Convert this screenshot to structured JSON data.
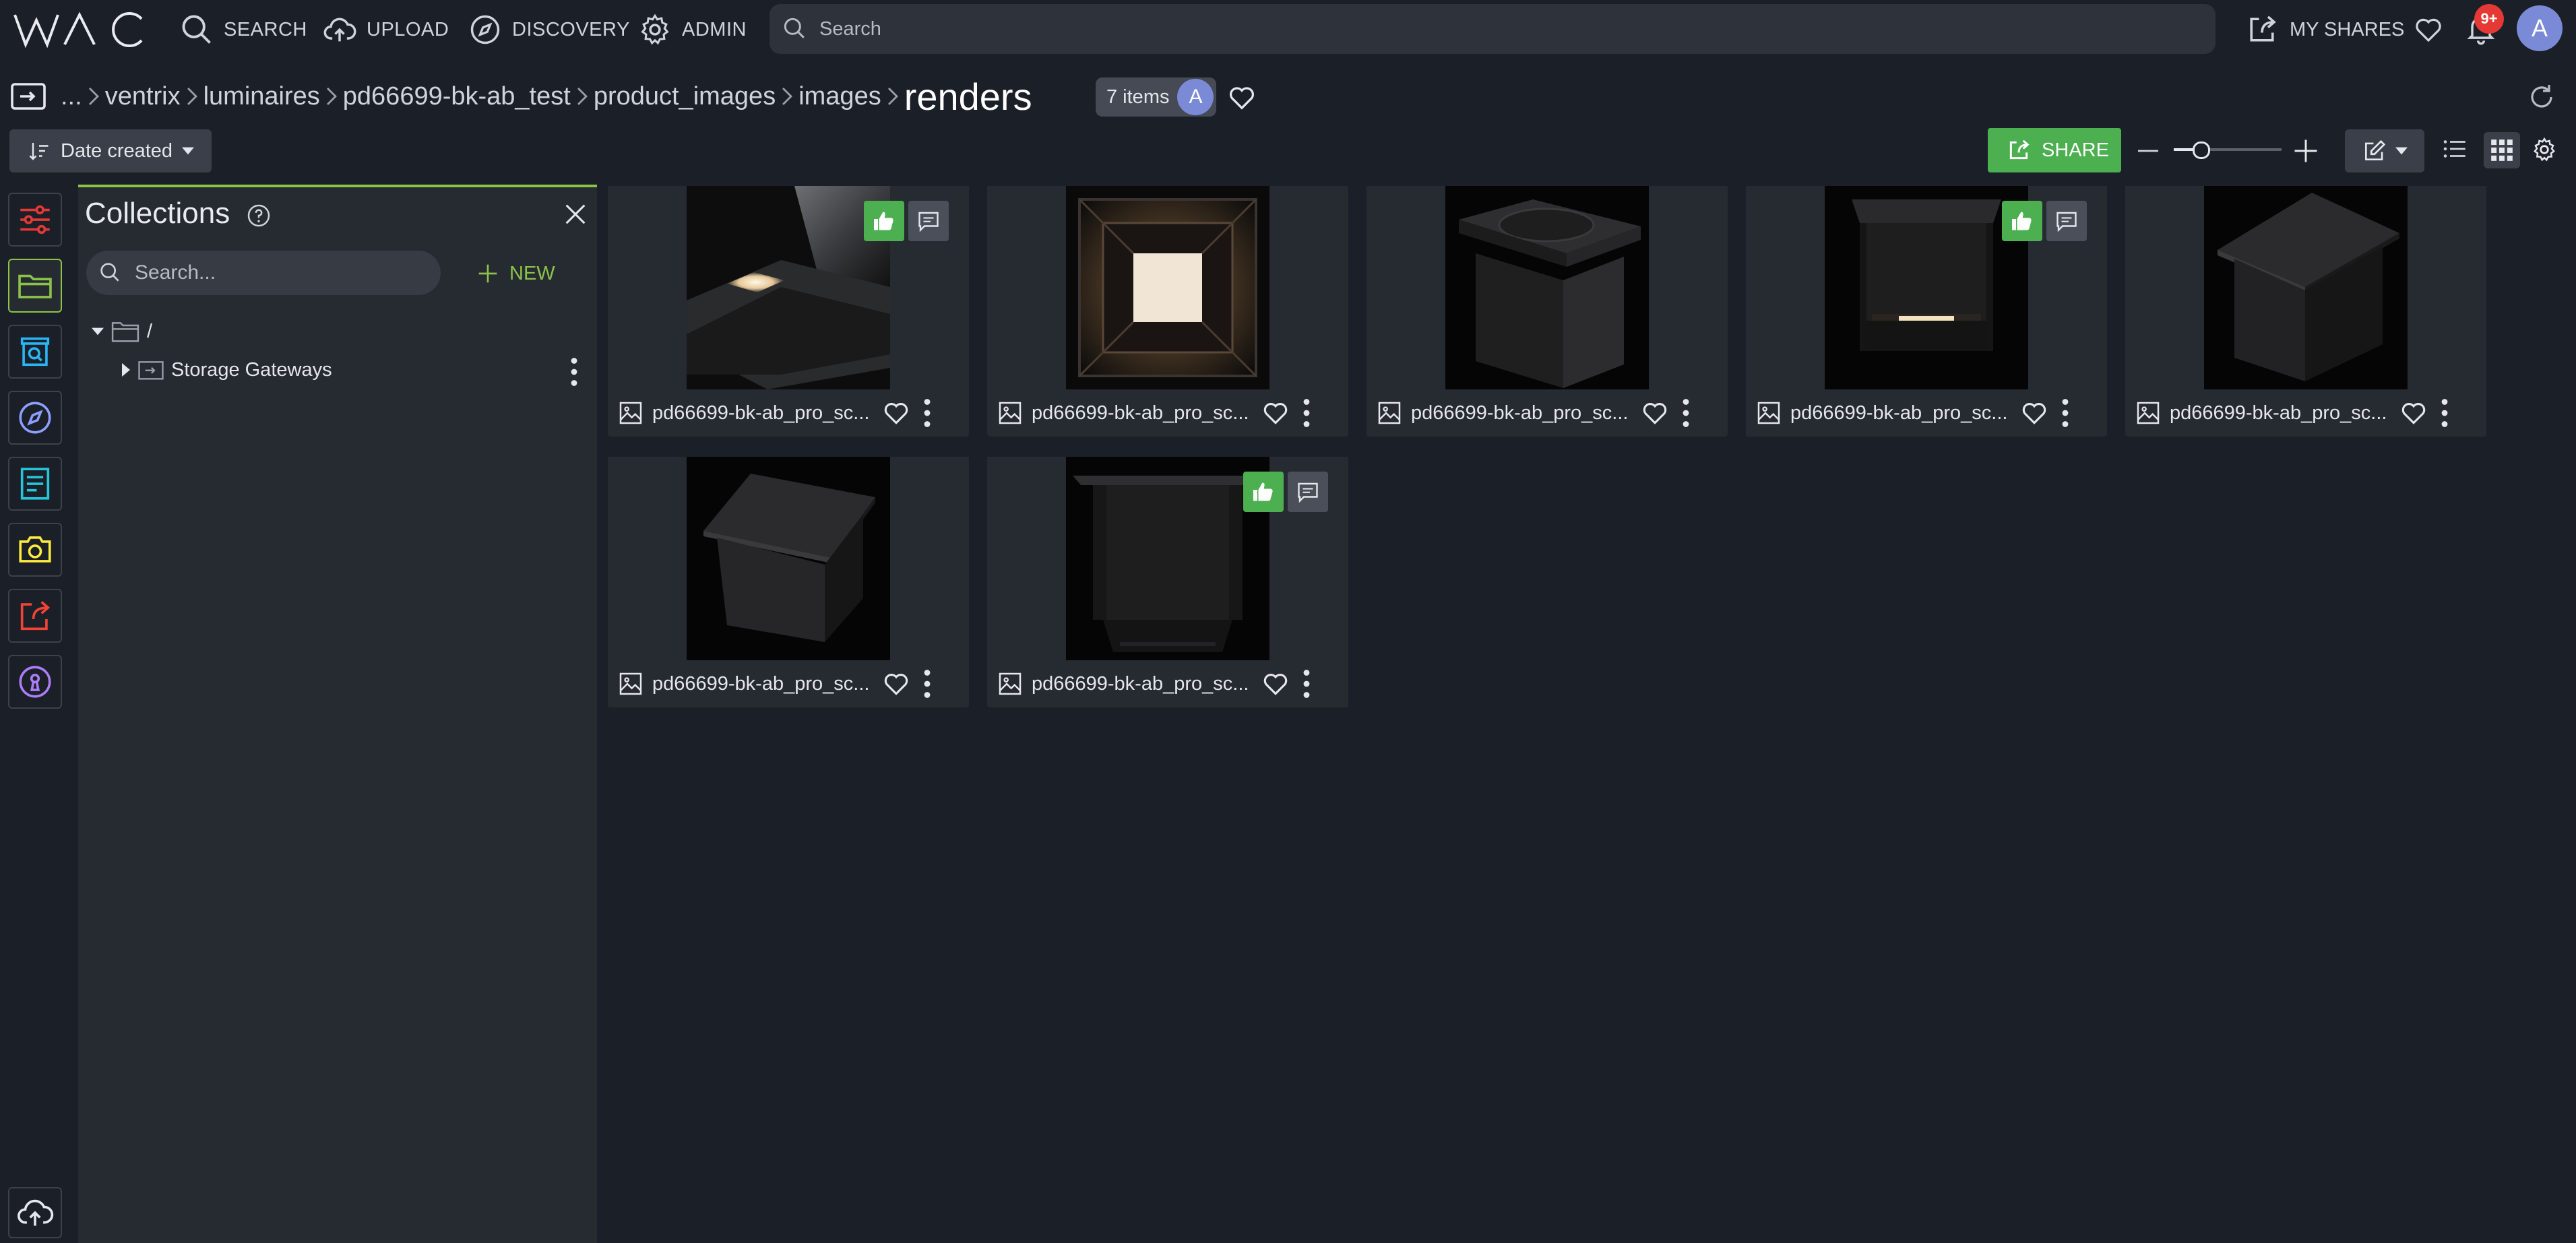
{
  "app": {
    "logo_text": "WAC"
  },
  "nav": {
    "search": "SEARCH",
    "upload": "UPLOAD",
    "discovery": "DISCOVERY",
    "admin": "ADMIN",
    "search_placeholder": "Search",
    "my_shares": "MY SHARES",
    "notifications_badge": "9+",
    "avatar_initial": "A"
  },
  "breadcrumb": {
    "ellipsis": "...",
    "items": [
      "ventrix",
      "luminaires",
      "pd66699-bk-ab_test",
      "product_images",
      "images"
    ],
    "current": "renders",
    "count_label": "7 items",
    "count_avatar": "A"
  },
  "toolbar": {
    "sort_label": "Date created",
    "share_label": "SHARE",
    "zoom_level": 0.25
  },
  "panel": {
    "title": "Collections",
    "search_placeholder": "Search...",
    "new_label": "NEW",
    "root_label": "/",
    "child_label": "Storage Gateways"
  },
  "assets": [
    {
      "name": "pd66699-bk-ab_pro_sc...",
      "render": "angled-lit-corner",
      "approved": true,
      "has_comment": true
    },
    {
      "name": "pd66699-bk-ab_pro_sc...",
      "render": "bottom-view-lit",
      "approved": false,
      "has_comment": false
    },
    {
      "name": "pd66699-bk-ab_pro_sc...",
      "render": "top-angled-box",
      "approved": false,
      "has_comment": false
    },
    {
      "name": "pd66699-bk-ab_pro_sc...",
      "render": "front-lit-slot",
      "approved": true,
      "has_comment": true
    },
    {
      "name": "pd66699-bk-ab_pro_sc...",
      "render": "angled-box-canopy",
      "approved": false,
      "has_comment": false
    },
    {
      "name": "pd66699-bk-ab_pro_sc...",
      "render": "angled-box-canopy-2",
      "approved": false,
      "has_comment": false
    },
    {
      "name": "pd66699-bk-ab_pro_sc...",
      "render": "front-box-canopy",
      "approved": true,
      "has_comment": true
    }
  ],
  "colors": {
    "accent_green": "#4caf50",
    "panel_accent": "#8bc34a",
    "badge_red": "#e53935",
    "avatar": "#7b8ad6"
  }
}
